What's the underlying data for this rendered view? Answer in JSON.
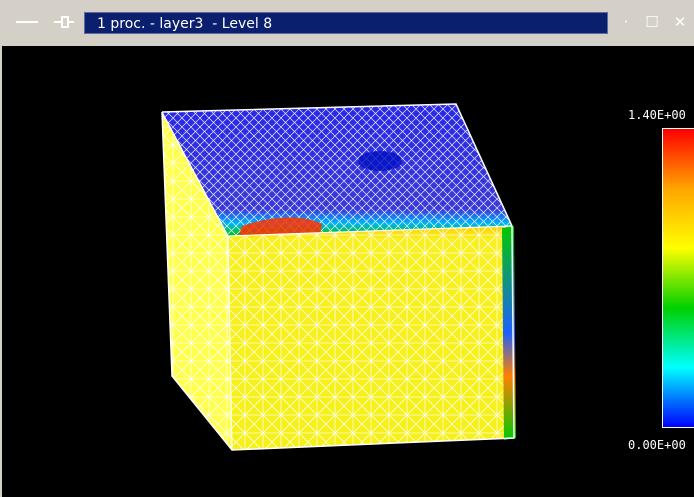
{
  "window": {
    "title": "1 proc. - layer3  - Level 8",
    "menu_icon": "window-menu-icon",
    "pin_icon": "pin-icon",
    "controls": {
      "minimize_symbol": "·",
      "maximize_symbol": "☐",
      "close_symbol": "✕"
    }
  },
  "colorbar": {
    "max_label": "1.40E+00",
    "min_label": "0.00E+00",
    "gradient": [
      "#ff0000",
      "#ffa500",
      "#ffff00",
      "#00d000",
      "#00ffff",
      "#0000ff"
    ]
  },
  "scene": {
    "background": "#000000",
    "mesh_color": "#ffffff",
    "top_face_color": "#3030e0",
    "front_face_color": "#f2f21e",
    "side_face_color": "#ffff40",
    "hot_color": "#ff3000",
    "edge_green": "#00c800"
  }
}
